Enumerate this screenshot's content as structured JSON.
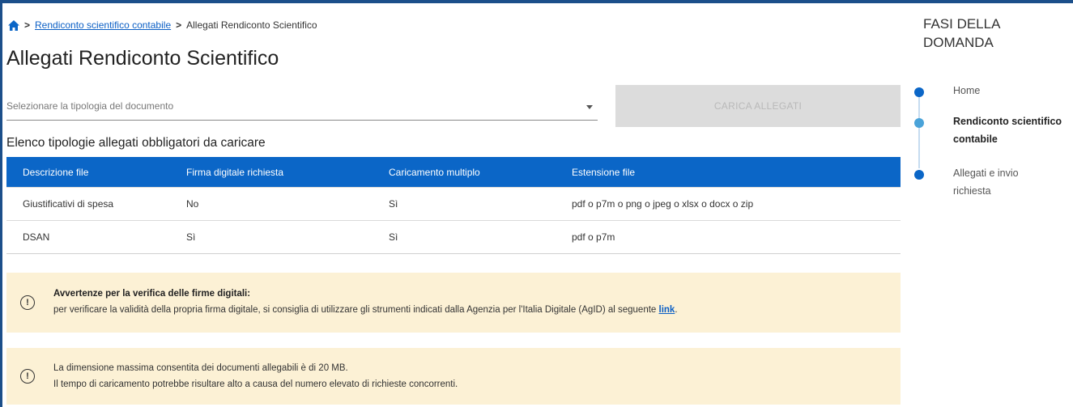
{
  "breadcrumb": {
    "link": "Rendiconto scientifico contabile",
    "current": "Allegati Rendiconto Scientifico",
    "separator": ">"
  },
  "page": {
    "title": "Allegati Rendiconto Scientifico"
  },
  "select": {
    "placeholder": "Selezionare la tipologia del documento"
  },
  "upload_button": {
    "label": "CARICA ALLEGATI",
    "disabled": true
  },
  "list": {
    "title": "Elenco tipologie allegati obbligatori da caricare",
    "headers": [
      "Descrizione file",
      "Firma digitale richiesta",
      "Caricamento multiplo",
      "Estensione file"
    ],
    "rows": [
      [
        "Giustificativi di spesa",
        "No",
        "Sì",
        "pdf o p7m o png o jpeg o xlsx o docx o zip"
      ],
      [
        "DSAN",
        "Sì",
        "Sì",
        "pdf o p7m"
      ]
    ]
  },
  "alerts": [
    {
      "title": "Avvertenze per la verifica delle firme digitali:",
      "text": "per verificare la validità della propria firma digitale, si consiglia di utilizzare gli strumenti indicati dalla Agenzia per l'Italia Digitale (AgID) al seguente ",
      "link": "link",
      "suffix": "."
    },
    {
      "line1": "La dimensione massima consentita dei documenti allegabili è di 20 MB.",
      "line2": "Il tempo di caricamento potrebbe risultare alto a causa del numero elevato di richieste concorrenti."
    }
  ],
  "sidebar": {
    "title": "FASI DELLA DOMANDA",
    "steps": [
      {
        "label": "Home",
        "state": "done"
      },
      {
        "label_line1": "Rendiconto scientifico",
        "label_line2": "contabile",
        "state": "active"
      },
      {
        "label_line1": "Allegati e invio",
        "label_line2": "richiesta",
        "state": "todo"
      }
    ]
  },
  "colors": {
    "brand_blue": "#0b66c7",
    "link_blue": "#0b5fc5",
    "alert_bg": "#fcf1d5",
    "step_done": "#0b66c7",
    "step_active": "#4aa3d9",
    "disabled_btn": "#dcdcdc"
  },
  "icons": {
    "home": "home-icon",
    "alert": "exclamation-circle-icon",
    "dropdown": "chevron-down-icon"
  }
}
